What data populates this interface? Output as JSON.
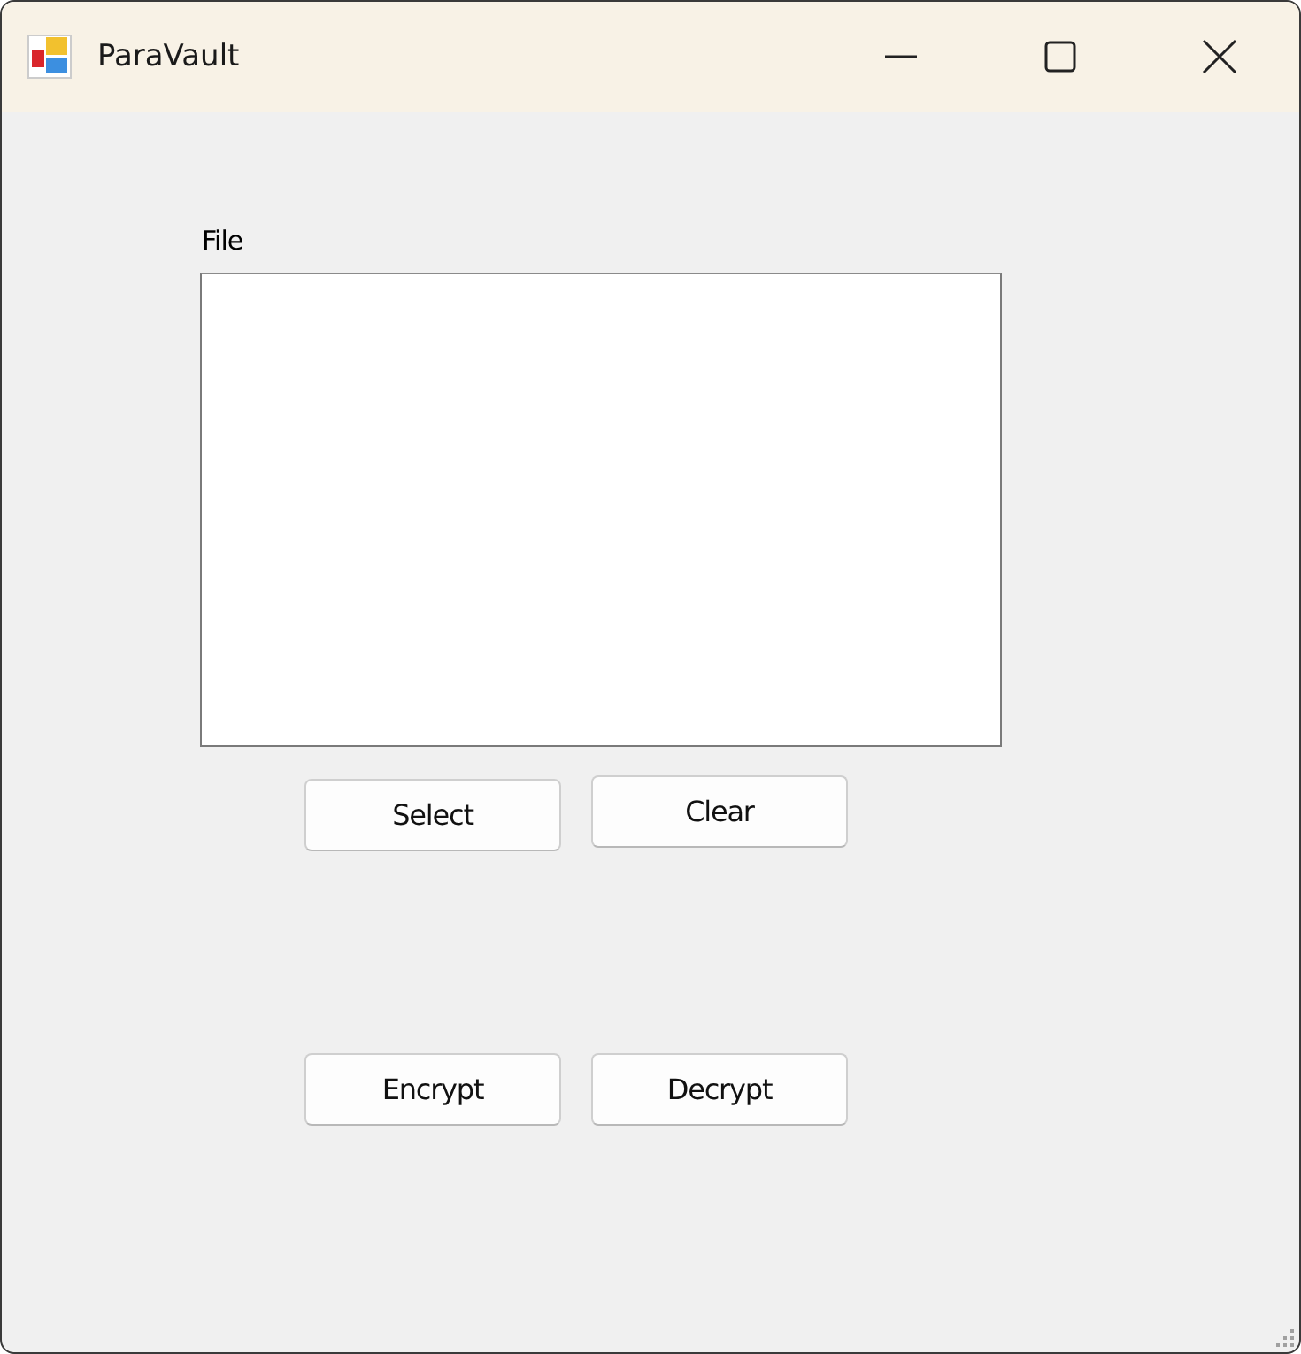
{
  "window": {
    "title": "ParaVault"
  },
  "file_label": "File",
  "file_buttons": [
    "Select",
    "Clear"
  ],
  "action_buttons": [
    "Encrypt",
    "Decrypt"
  ]
}
